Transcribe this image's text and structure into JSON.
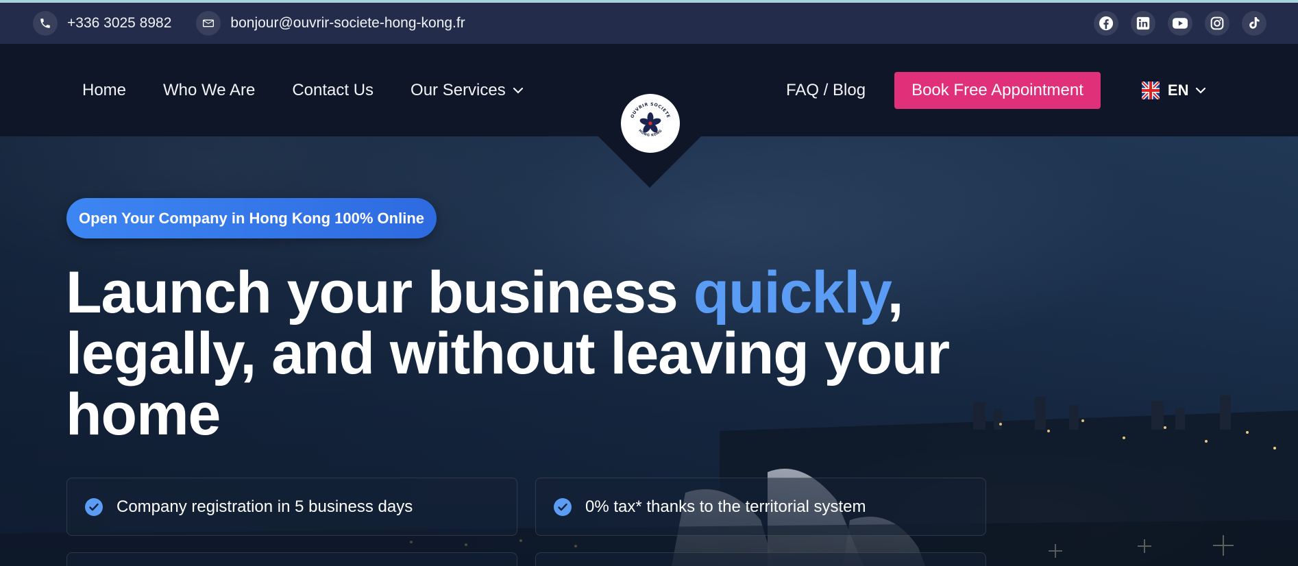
{
  "topbar": {
    "phone": "+336 3025 8982",
    "email": "bonjour@ouvrir-societe-hong-kong.fr",
    "socials": [
      "facebook-icon",
      "linkedin-icon",
      "youtube-icon",
      "instagram-icon",
      "tiktok-icon"
    ]
  },
  "nav": {
    "links": [
      "Home",
      "Who We Are",
      "Contact Us",
      "Our Services"
    ],
    "faq": "FAQ / Blog",
    "cta": "Book Free Appointment",
    "language": "EN"
  },
  "logo": {
    "text_top": "OUVRIR SOCIETE",
    "text_bottom": "HONG KONG"
  },
  "hero": {
    "pill": "Open Your Company in Hong Kong 100% Online",
    "headline_pre": "Launch your business ",
    "headline_highlight": "quickly",
    "headline_post": ", legally, and without leaving your home",
    "features": [
      "Company registration in 5 business days",
      "0% tax* thanks to the territorial system"
    ]
  },
  "colors": {
    "accent_blue": "#5b9cf5",
    "cta_pink": "#e0307a",
    "nav_bg": "#0f1628",
    "topbar_bg": "#232c4a"
  }
}
